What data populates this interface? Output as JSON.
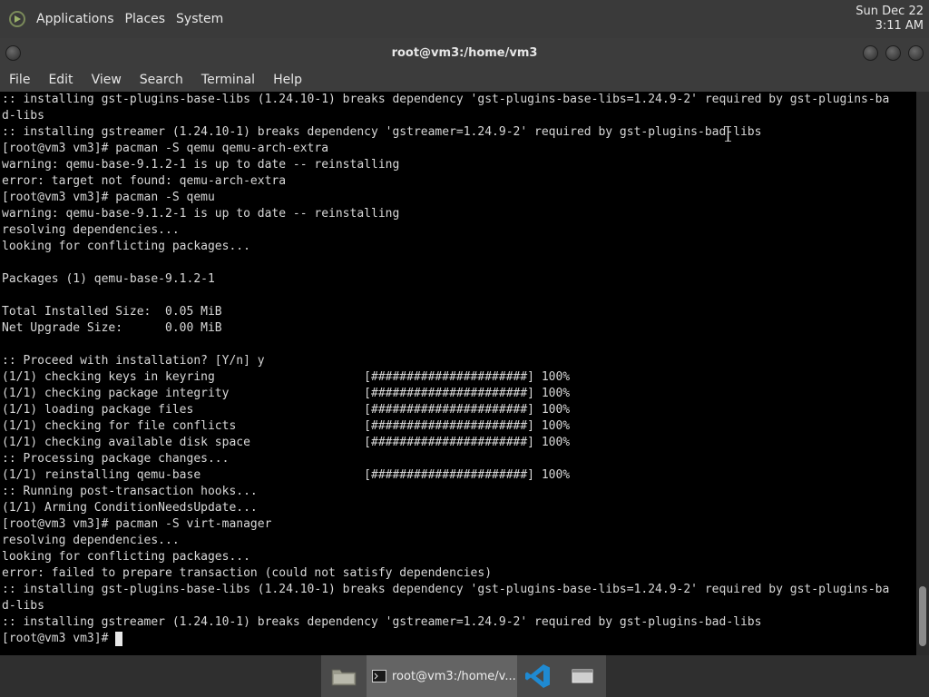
{
  "top_panel": {
    "menus": [
      "Applications",
      "Places",
      "System"
    ],
    "clock": {
      "date": "Sun Dec 22",
      "time": "3:11 AM"
    }
  },
  "window": {
    "title": "root@vm3:/home/vm3",
    "menu": [
      "File",
      "Edit",
      "View",
      "Search",
      "Terminal",
      "Help"
    ]
  },
  "terminal": {
    "lines": [
      ":: installing gst-plugins-base-libs (1.24.10-1) breaks dependency 'gst-plugins-base-libs=1.24.9-2' required by gst-plugins-ba",
      "d-libs",
      ":: installing gstreamer (1.24.10-1) breaks dependency 'gstreamer=1.24.9-2' required by gst-plugins-bad-libs",
      "[root@vm3 vm3]# pacman -S qemu qemu-arch-extra",
      "warning: qemu-base-9.1.2-1 is up to date -- reinstalling",
      "error: target not found: qemu-arch-extra",
      "[root@vm3 vm3]# pacman -S qemu",
      "warning: qemu-base-9.1.2-1 is up to date -- reinstalling",
      "resolving dependencies...",
      "looking for conflicting packages...",
      "",
      "Packages (1) qemu-base-9.1.2-1",
      "",
      "Total Installed Size:  0.05 MiB",
      "Net Upgrade Size:      0.00 MiB",
      "",
      ":: Proceed with installation? [Y/n] y",
      "(1/1) checking keys in keyring                     [######################] 100%",
      "(1/1) checking package integrity                   [######################] 100%",
      "(1/1) loading package files                        [######################] 100%",
      "(1/1) checking for file conflicts                  [######################] 100%",
      "(1/1) checking available disk space                [######################] 100%",
      ":: Processing package changes...",
      "(1/1) reinstalling qemu-base                       [######################] 100%",
      ":: Running post-transaction hooks...",
      "(1/1) Arming ConditionNeedsUpdate...",
      "[root@vm3 vm3]# pacman -S virt-manager",
      "resolving dependencies...",
      "looking for conflicting packages...",
      "error: failed to prepare transaction (could not satisfy dependencies)",
      ":: installing gst-plugins-base-libs (1.24.10-1) breaks dependency 'gst-plugins-base-libs=1.24.9-2' required by gst-plugins-ba",
      "d-libs",
      ":: installing gstreamer (1.24.10-1) breaks dependency 'gstreamer=1.24.9-2' required by gst-plugins-bad-libs"
    ],
    "prompt": "[root@vm3 vm3]# "
  },
  "taskbar": {
    "items": [
      {
        "icon": "file-manager-icon"
      },
      {
        "icon": "terminal-icon",
        "label": "root@vm3:/home/v..."
      },
      {
        "icon": "vscode-icon"
      },
      {
        "icon": "window-icon"
      }
    ]
  },
  "colors": {
    "panel": "#3a3a3a",
    "terminal_bg": "#000000",
    "terminal_fg": "#d8d8d8",
    "vscode_blue": "#1f8ad2"
  }
}
